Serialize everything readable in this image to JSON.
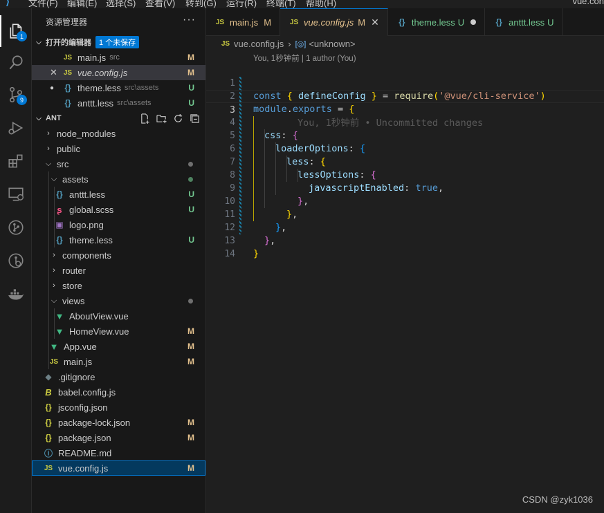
{
  "menubar": {
    "items": [
      "文件(F)",
      "编辑(E)",
      "选择(S)",
      "查看(V)",
      "转到(G)",
      "运行(R)",
      "终端(T)",
      "帮助(H)"
    ],
    "title": "vue.con"
  },
  "activitybar": {
    "explorer_badge": "1",
    "scm_badge": "9"
  },
  "sidebar": {
    "title": "资源管理器",
    "more": "···",
    "open_editors": {
      "label": "打开的编辑器",
      "unsaved": "1 个未保存",
      "files": [
        {
          "icon": "JS",
          "name": "main.js",
          "sub": "src",
          "status": "M"
        },
        {
          "icon": "JS",
          "name": "vue.config.js",
          "sub": "",
          "status": "M"
        },
        {
          "icon": "{}",
          "name": "theme.less",
          "sub": "src\\assets",
          "status": "U"
        },
        {
          "icon": "{}",
          "name": "anttt.less",
          "sub": "src\\assets",
          "status": "U"
        }
      ]
    },
    "project": {
      "label": "ANT",
      "items": [
        {
          "name": "node_modules"
        },
        {
          "name": "public"
        },
        {
          "name": "src"
        },
        {
          "name": "assets"
        },
        {
          "name": "anttt.less",
          "status": "U"
        },
        {
          "name": "global.scss",
          "status": "U"
        },
        {
          "name": "logo.png"
        },
        {
          "name": "theme.less",
          "status": "U"
        },
        {
          "name": "components"
        },
        {
          "name": "router"
        },
        {
          "name": "store"
        },
        {
          "name": "views"
        },
        {
          "name": "AboutView.vue"
        },
        {
          "name": "HomeView.vue",
          "status": "M"
        },
        {
          "name": "App.vue",
          "status": "M"
        },
        {
          "name": "main.js",
          "status": "M"
        },
        {
          "name": ".gitignore"
        },
        {
          "name": "babel.config.js"
        },
        {
          "name": "jsconfig.json"
        },
        {
          "name": "package-lock.json",
          "status": "M"
        },
        {
          "name": "package.json",
          "status": "M"
        },
        {
          "name": "README.md"
        },
        {
          "name": "vue.config.js",
          "status": "M"
        }
      ]
    }
  },
  "editor": {
    "tabs": [
      {
        "icon": "JS",
        "label": "main.js",
        "status": "M"
      },
      {
        "icon": "JS",
        "label": "vue.config.js",
        "status": "M",
        "close": "✕"
      },
      {
        "icon": "{}",
        "label": "theme.less",
        "status": "U"
      },
      {
        "icon": "{}",
        "label": "anttt.less",
        "status": "U"
      }
    ],
    "breadcrumb": {
      "file": "vue.config.js",
      "sep": "›",
      "symbol": "<unknown>"
    },
    "codelens": "You, 1秒钟前 | 1 author (You)",
    "blame": "You, 1秒钟前 • Uncommitted changes",
    "line_numbers": [
      "1",
      "2",
      "3",
      "4",
      "5",
      "6",
      "7",
      "8",
      "9",
      "10",
      "11",
      "12",
      "13",
      "14"
    ],
    "code": {
      "l1": {
        "kw": "const",
        "a": " ",
        "b1": "{",
        "id": " defineConfig ",
        "b2": "}",
        "eq": " = ",
        "fn": "require",
        "p1": "(",
        "str": "'@vue/cli-service'",
        "p2": ")"
      },
      "l2": {
        "a": "module",
        "dot": ".",
        "b": "exports",
        "eq": " = ",
        "br": "{"
      },
      "l4": {
        "key": "css",
        "colon": ": ",
        "br": "{"
      },
      "l5": {
        "key": "loaderOptions",
        "colon": ": ",
        "br": "{"
      },
      "l6": {
        "key": "less",
        "colon": ": ",
        "br": "{"
      },
      "l7": {
        "key": "lessOptions",
        "colon": ": ",
        "br": "{"
      },
      "l8": {
        "key": "javascriptEnabled",
        "colon": ": ",
        "val": "true",
        "comma": ","
      },
      "l9": {
        "br": "}",
        "comma": ","
      },
      "l10": {
        "br": "}",
        "comma": ","
      },
      "l11": {
        "br": "}",
        "comma": ","
      },
      "l12": {
        "br": "}",
        "comma": ","
      },
      "l13": {
        "br": "}"
      }
    }
  },
  "watermark": "CSDN @zyk1036"
}
